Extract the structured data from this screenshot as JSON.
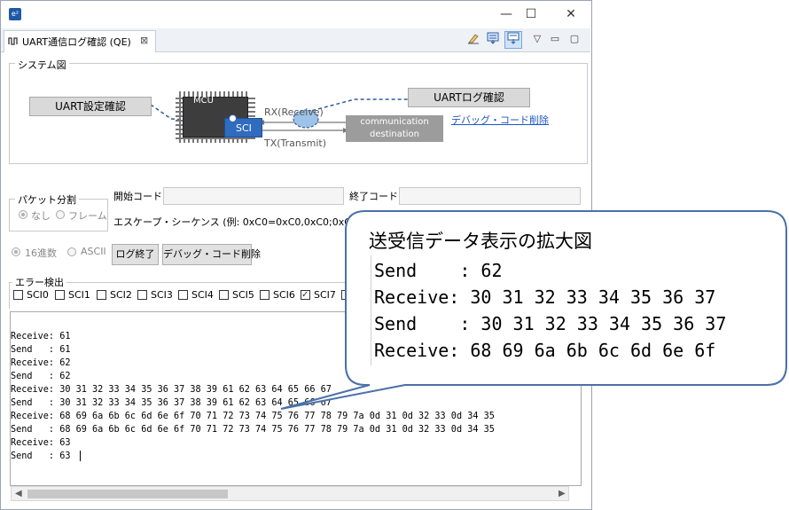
{
  "window": {
    "app_icon_text": "e²",
    "minimize": "—",
    "maximize": "☐",
    "close": "✕"
  },
  "tab": {
    "label": "UART通信ログ確認 (QE)",
    "close": "⊠"
  },
  "toolbar": {
    "menu_label": "▽",
    "min_label": "▭",
    "max_label": "▢"
  },
  "system_diagram": {
    "title": "システム図",
    "uart_settings_button": "UART設定確認",
    "uart_log_button": "UARTログ確認",
    "debug_code_delete_link": "デバッグ・コード削除",
    "mcu_label": "MCU",
    "sci_label": "SCI",
    "rx_label": "RX(Receive)",
    "tx_label": "TX(Transmit)",
    "destination_line1": "communication",
    "destination_line2": "destination"
  },
  "packet_split": {
    "title": "パケット分割",
    "option_none": "なし",
    "option_frame": "フレーム",
    "selected": "なし"
  },
  "codes": {
    "start_code_label": "開始コード:",
    "end_code_label": "終了コード:",
    "start_code_value": "",
    "end_code_value": "",
    "escape_label": "エスケープ・シーケンス (例: 0xC0=0xC0,0xC0;0xC1=0xC0,0"
  },
  "display_format": {
    "hex": "16進数",
    "ascii": "ASCII",
    "selected": "16進数",
    "log_stop_button": "ログ終了",
    "debug_delete_button": "デバッグ・コード削除"
  },
  "error_detect": {
    "title": "エラー検出",
    "channels": [
      "SCI0",
      "SCI1",
      "SCI2",
      "SCI3",
      "SCI4",
      "SCI5",
      "SCI6",
      "SCI7"
    ],
    "checked": [
      "SCI7"
    ]
  },
  "log": {
    "lines": [
      "Receive: 61",
      "Send   : 61",
      "Receive: 62",
      "Send   : 62",
      "Receive: 30 31 32 33 34 35 36 37 38 39 61 62 63 64 65 66 67",
      "Send   : 30 31 32 33 34 35 36 37 38 39 61 62 63 64 65 66 67",
      "Receive: 68 69 6a 6b 6c 6d 6e 6f 70 71 72 73 74 75 76 77 78 79 7a 0d 31 0d 32 33 0d 34 35",
      "Send   : 68 69 6a 6b 6c 6d 6e 6f 70 71 72 73 74 75 76 77 78 79 7a 0d 31 0d 32 33 0d 34 35",
      "Receive: 63",
      "Send   : 63"
    ]
  },
  "callout": {
    "title": "送受信データ表示の拡大図",
    "lines": [
      "Send    : 62",
      "Receive: 30 31 32 33 34 35 36 37",
      "Send    : 30 31 32 33 34 35 36 37",
      "Receive: 68 69 6a 6b 6c 6d 6e 6f"
    ]
  },
  "colors": {
    "sci_blue": "#2f6bbf",
    "link_blue": "#1f56c4",
    "callout_border": "#4a70a8"
  }
}
